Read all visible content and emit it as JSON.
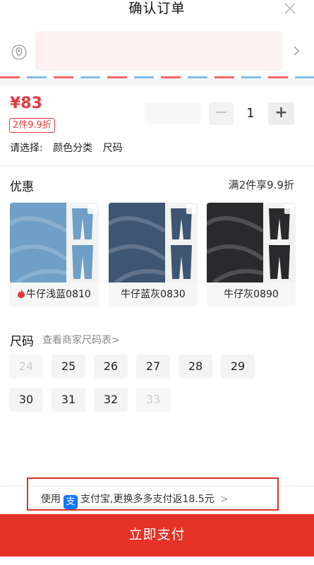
{
  "header": {
    "title": "确认订单",
    "close_icon": "close-icon"
  },
  "address": {
    "location_icon": "location-pin-icon",
    "arrow_icon": "chevron-right-icon"
  },
  "product": {
    "price": "¥83",
    "discount_badge": "2件9.9折",
    "quantity": "1",
    "minus_label": "−",
    "plus_label": "+",
    "select_prefix": "请选择:",
    "select_options": [
      "颜色分类",
      "尺码"
    ]
  },
  "promo": {
    "label": "优惠",
    "rule": "满2件享9.9折",
    "skus": [
      {
        "label": "牛仔浅蓝0810",
        "hot": true,
        "color": "#6f9fc6"
      },
      {
        "label": "牛仔蓝灰0830",
        "hot": false,
        "color": "#3f5672"
      },
      {
        "label": "牛仔灰0890",
        "hot": false,
        "color": "#2a2a2c"
      }
    ]
  },
  "sizes": {
    "title": "尺码",
    "chart_link": "查看商家尺码表",
    "chart_arrow": ">",
    "options": [
      {
        "value": "24",
        "available": false
      },
      {
        "value": "25",
        "available": true
      },
      {
        "value": "26",
        "available": true
      },
      {
        "value": "27",
        "available": true
      },
      {
        "value": "28",
        "available": true
      },
      {
        "value": "29",
        "available": true
      },
      {
        "value": "30",
        "available": true
      },
      {
        "value": "31",
        "available": true
      },
      {
        "value": "32",
        "available": true
      },
      {
        "value": "33",
        "available": false
      }
    ]
  },
  "payment": {
    "prefix": "使用",
    "alipay_glyph": "支",
    "method": "支付宝,更换多多支付返18.5元",
    "arrow": ">",
    "button_label": "立即支付"
  },
  "colors": {
    "accent": "#e63228",
    "alipay": "#1677ff"
  }
}
